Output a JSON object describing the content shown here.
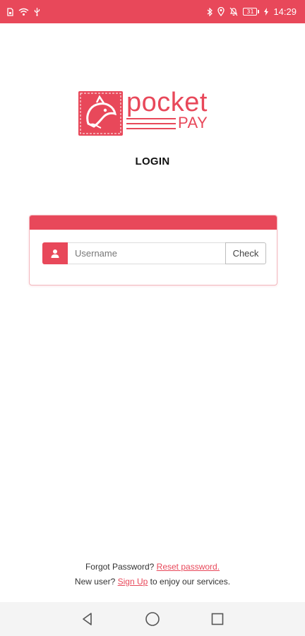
{
  "status_bar": {
    "battery": "31",
    "time": "14:29",
    "left_icons": [
      "sim-icon",
      "wifi-icon",
      "usb-icon"
    ],
    "right_icons": [
      "bluetooth-icon",
      "location-icon",
      "mute-icon",
      "battery-icon",
      "charging-icon"
    ]
  },
  "logo": {
    "word": "pocket",
    "sub": "PAY"
  },
  "login": {
    "title": "LOGIN"
  },
  "form": {
    "username_placeholder": "Username",
    "username_value": "",
    "check_label": "Check"
  },
  "footer": {
    "forgot_text": "Forgot Password?",
    "reset_link": "Reset password.",
    "new_user_text": "New user?",
    "signup_link": "Sign Up",
    "services_text": "to enjoy our services."
  },
  "nav": [
    "back-icon",
    "home-icon",
    "recents-icon"
  ],
  "colors": {
    "accent": "#e8485a"
  }
}
